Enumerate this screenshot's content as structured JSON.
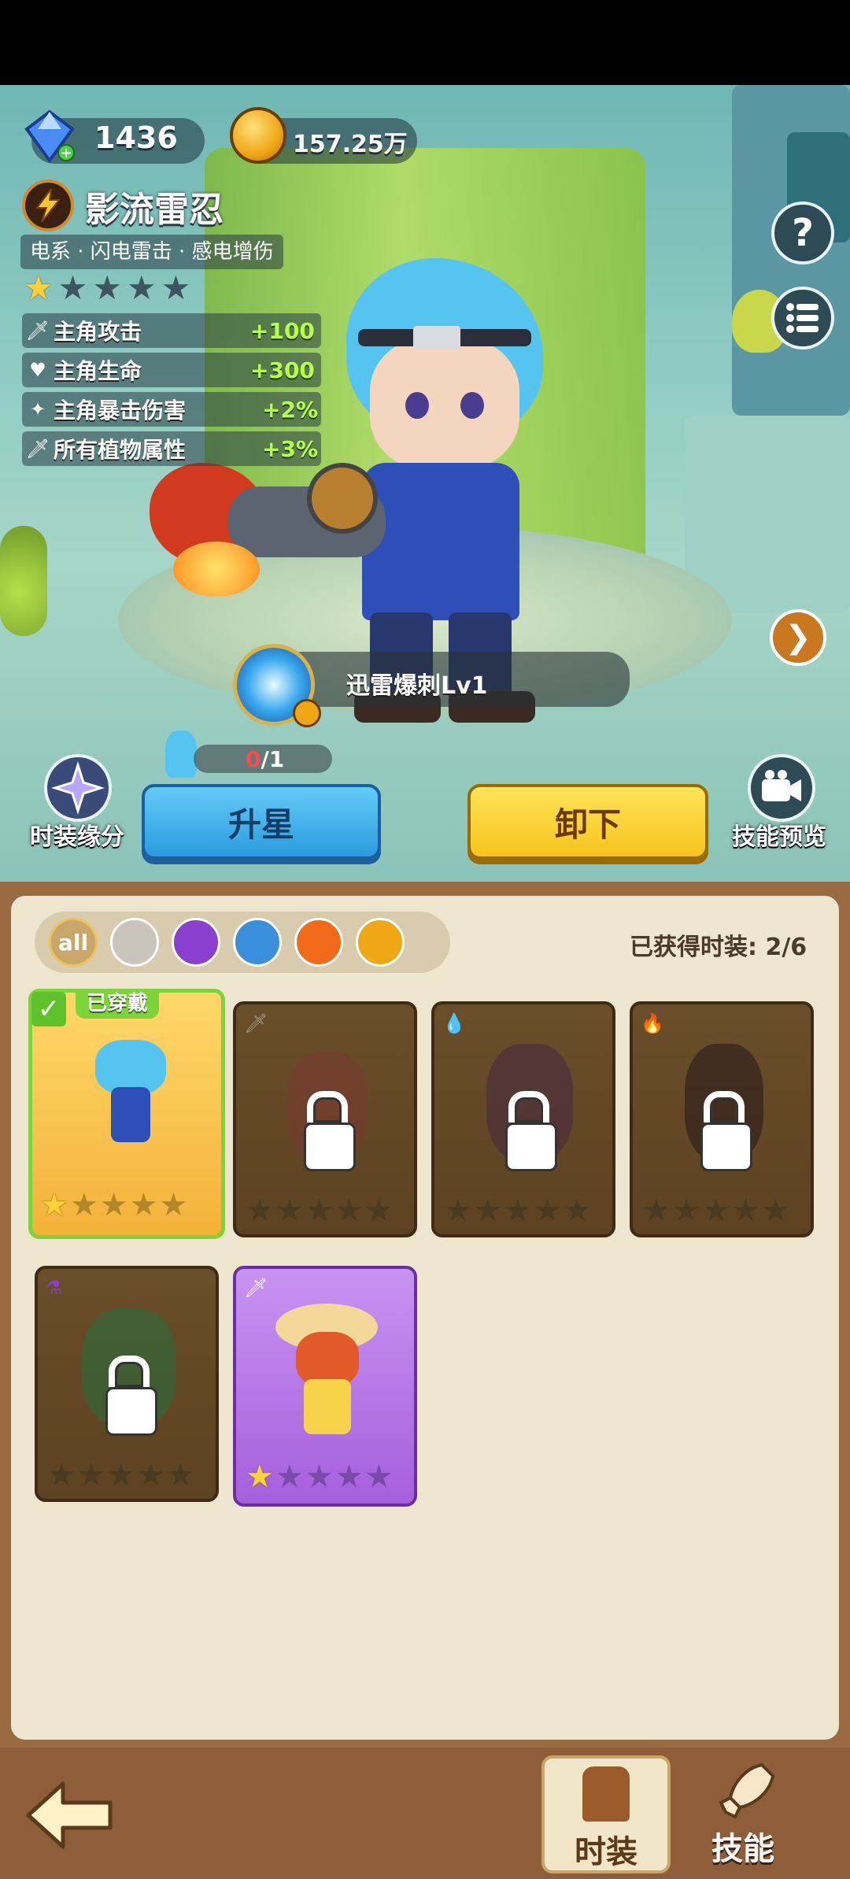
{
  "resources": {
    "gems": "1436",
    "coins": "157.25万"
  },
  "hero": {
    "name": "影流雷忍",
    "tags": "电系 · 闪电雷击 · 感电增伤",
    "stars_lit": 1,
    "stars_total": 5,
    "stats": [
      {
        "label": "主角攻击",
        "value": "+100"
      },
      {
        "label": "主角生命",
        "value": "+300"
      },
      {
        "label": "主角暴击伤害",
        "value": "+2%"
      },
      {
        "label": "所有植物属性",
        "value": "+3%"
      }
    ],
    "skill_name": "迅雷爆刺Lv1",
    "progress_current": "0",
    "progress_total": "/1",
    "progress_fraction": 0
  },
  "side_buttons": {
    "help": "?",
    "skin_bond": "时装缘分",
    "skill_preview": "技能预览"
  },
  "actions": {
    "upgrade": "升星",
    "unequip": "卸下"
  },
  "collection": {
    "filters": [
      "all",
      "sword-icon",
      "potion-icon",
      "water-drop-icon",
      "fire-icon",
      "lightning-icon"
    ],
    "filter_all_label": "all",
    "owned_label": "已获得时装: 2/6",
    "equipped_label": "已穿戴",
    "cards": [
      {
        "element": "lightning",
        "locked": false,
        "equipped": true,
        "stars": 1
      },
      {
        "element": "sword",
        "locked": true,
        "equipped": false,
        "stars": 0
      },
      {
        "element": "water",
        "locked": true,
        "equipped": false,
        "stars": 0
      },
      {
        "element": "fire",
        "locked": true,
        "equipped": false,
        "stars": 0
      },
      {
        "element": "potion",
        "locked": true,
        "equipped": false,
        "stars": 0
      },
      {
        "element": "sword",
        "locked": false,
        "equipped": false,
        "stars": 1
      }
    ]
  },
  "nav": {
    "skins": "时装",
    "skills": "技能"
  },
  "colors": {
    "upgrade_btn": "#3fb4ef",
    "unequip_btn": "#ffd52e",
    "stat_value": "#b8ff4a",
    "equipped_border": "#7cd33a",
    "purple_card": "#b06ee0"
  }
}
